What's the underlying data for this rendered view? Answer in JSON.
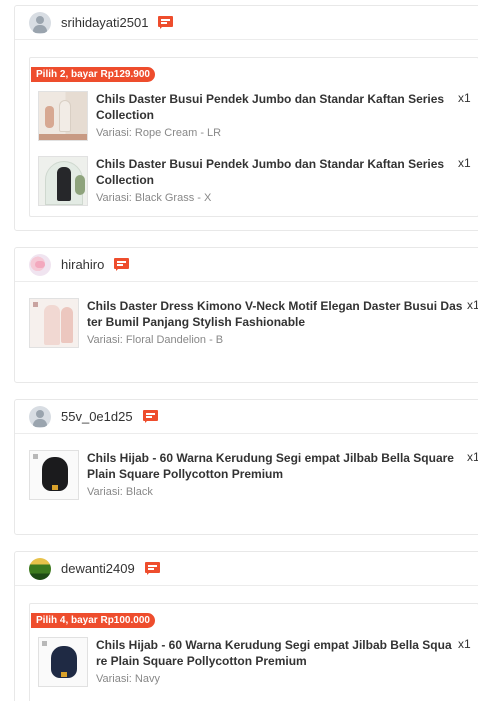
{
  "colors": {
    "accent": "#ee4d2d",
    "border": "#e8e8e8",
    "muted": "#888888"
  },
  "orders": [
    {
      "username": "srihidayati2501",
      "avatar": "default-avatar-icon",
      "promo": "Pilih 2, bayar Rp129.900",
      "items": [
        {
          "name": "Chils Daster Busui Pendek Jumbo dan Standar Kaftan Series Collection",
          "variant": "Variasi: Rope Cream - LR",
          "qty": "x1"
        },
        {
          "name": "Chils Daster Busui Pendek Jumbo dan Standar Kaftan Series Collection",
          "variant": "Variasi: Black Grass - X",
          "qty": "x1"
        }
      ]
    },
    {
      "username": "hirahiro",
      "avatar": "user-photo-avatar",
      "items": [
        {
          "name": "Chils Daster Dress Kimono V-Neck Motif Elegan Daster Busui Daster Bumil Panjang Stylish Fashionable",
          "variant": "Variasi: Floral Dandelion - B",
          "qty": "x1"
        }
      ]
    },
    {
      "username": "55v_0e1d25",
      "avatar": "default-avatar-icon",
      "items": [
        {
          "name": "Chils Hijab - 60 Warna Kerudung Segi empat Jilbab Bella Square Plain Square Pollycotton Premium",
          "variant": "Variasi: Black",
          "qty": "x1"
        }
      ]
    },
    {
      "username": "dewanti2409",
      "avatar": "user-photo-avatar",
      "promo": "Pilih 4, bayar Rp100.000",
      "items": [
        {
          "name": "Chils Hijab - 60 Warna Kerudung Segi empat Jilbab Bella Square Plain Square Pollycotton Premium",
          "variant": "Variasi: Navy",
          "qty": "x1"
        }
      ]
    }
  ]
}
